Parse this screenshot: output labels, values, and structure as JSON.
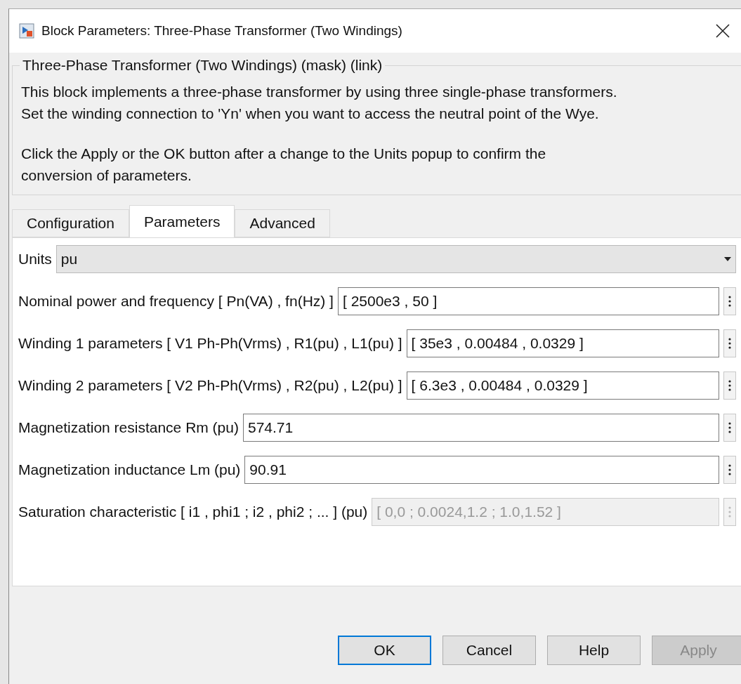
{
  "window": {
    "title": "Block Parameters: Three-Phase Transformer (Two Windings)"
  },
  "group": {
    "legend": "Three-Phase Transformer (Two Windings) (mask) (link)",
    "paragraphs": [
      "This block implements a three-phase transformer by using three single-phase transformers.\nSet the winding connection to 'Yn'  when you want to access the neutral point of the Wye.",
      "Click the Apply or the OK button after a change to the Units popup to confirm the\nconversion of parameters."
    ]
  },
  "tabs": [
    {
      "label": "Configuration",
      "selected": false
    },
    {
      "label": "Parameters",
      "selected": true
    },
    {
      "label": "Advanced",
      "selected": false
    }
  ],
  "parameters": [
    {
      "kind": "dropdown",
      "label": "Units",
      "value": "pu",
      "disabled": false
    },
    {
      "kind": "edit",
      "label": "Nominal power and frequency  [ Pn(VA) , fn(Hz) ]",
      "value": "[ 2500e3 , 50 ]",
      "disabled": false
    },
    {
      "kind": "edit",
      "label": "Winding 1 parameters [ V1 Ph-Ph(Vrms) , R1(pu) , L1(pu) ]",
      "value": "[ 35e3 , 0.00484 , 0.0329 ]",
      "disabled": false
    },
    {
      "kind": "edit",
      "label": "Winding 2 parameters [ V2 Ph-Ph(Vrms) , R2(pu) , L2(pu) ]",
      "value": "[ 6.3e3 , 0.00484 , 0.0329 ]",
      "disabled": false
    },
    {
      "kind": "edit",
      "label": "Magnetization resistance  Rm (pu)",
      "value": "574.71",
      "disabled": false
    },
    {
      "kind": "edit",
      "label": "Magnetization inductance  Lm (pu)",
      "value": "90.91",
      "disabled": false
    },
    {
      "kind": "edit",
      "label": "Saturation characteristic [ i1 ,  phi1 ;  i2 , phi2 ; ... ] (pu)",
      "value": "[ 0,0 ; 0.0024,1.2 ; 1.0,1.52 ]",
      "disabled": true
    }
  ],
  "buttons": [
    {
      "label": "OK",
      "selected": true,
      "disabled": false
    },
    {
      "label": "Cancel",
      "selected": false,
      "disabled": false
    },
    {
      "label": "Help",
      "selected": false,
      "disabled": false
    },
    {
      "label": "Apply",
      "selected": false,
      "disabled": true
    }
  ]
}
